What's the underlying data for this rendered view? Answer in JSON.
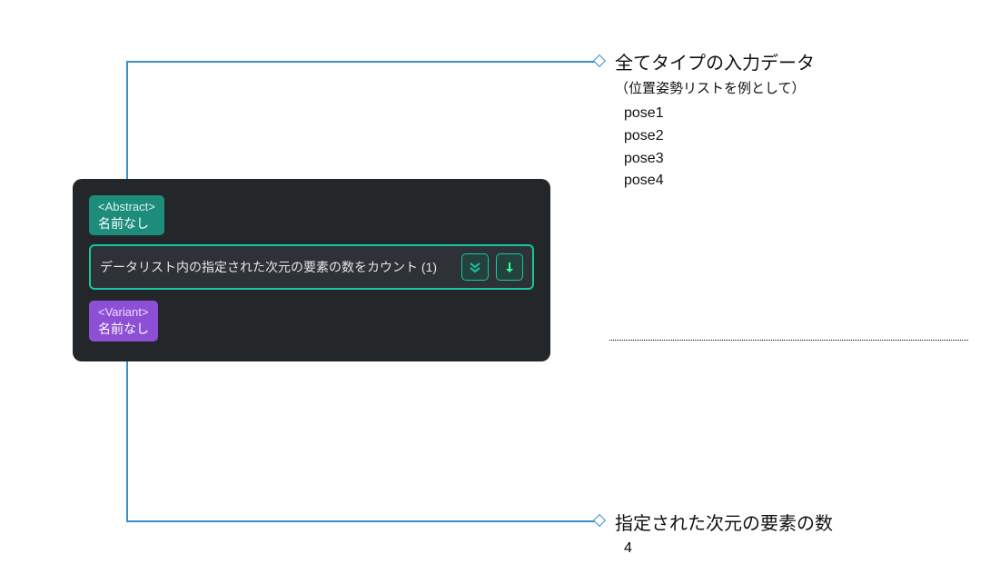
{
  "connectors": {
    "top_color": "#3b8fc9",
    "bottom_color": "#3b8fc9"
  },
  "node": {
    "abstract": {
      "type_label": "<Abstract>",
      "name": "名前なし"
    },
    "instruction_text": "データリスト内の指定された次元の要素の数をカウント (1)",
    "variant": {
      "type_label": "<Variant>",
      "name": "名前なし"
    },
    "icons": {
      "expand_all": "expand-chevrons",
      "down_arrow": "down-arrow"
    }
  },
  "annotations": {
    "top": {
      "title": "全てタイプの入力データ",
      "subtitle": "（位置姿勢リストを例として）",
      "items": [
        "pose1",
        "pose2",
        "pose3",
        "pose4"
      ]
    },
    "bottom": {
      "title": "指定された次元の要素の数",
      "value": "4"
    }
  }
}
